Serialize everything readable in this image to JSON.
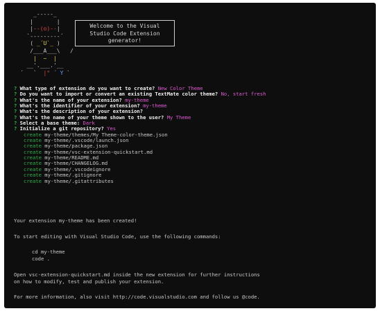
{
  "welcome_box": [
    "Welcome to the Visual",
    "Studio Code Extension",
    "generator!"
  ],
  "prompts": [
    {
      "mark": "?",
      "question": "What type of extension do you want to create?",
      "answer": "New Color Theme"
    },
    {
      "mark": "?",
      "question": "Do you want to import or convert an existing TextMate color theme?",
      "answer": "No, start fresh"
    },
    {
      "mark": "?",
      "question": "What's the name of your extension?",
      "answer": "my-theme"
    },
    {
      "mark": "?",
      "question": "What's the identifier of your extension?",
      "answer": "my-theme"
    },
    {
      "mark": "?",
      "question": "What's the description of your extension?",
      "answer": ""
    },
    {
      "mark": "?",
      "question": "What's the name of your theme shown to the user?",
      "answer": "My Theme"
    },
    {
      "mark": "?",
      "question": "Select a base theme:",
      "answer": "Dark"
    },
    {
      "mark": "?",
      "question": "Initialize a git repository?",
      "answer": "Yes"
    }
  ],
  "create_word": "create",
  "created_files": [
    "my-theme/themes/My Theme-color-theme.json",
    "my-theme/.vscode/launch.json",
    "my-theme/package.json",
    "my-theme/vsc-extension-quickstart.md",
    "my-theme/README.md",
    "my-theme/CHANGELOG.md",
    "my-theme/.vscodeignore",
    "my-theme/.gitignore",
    "my-theme/.gitattributes"
  ],
  "messages": {
    "created": "Your extension my-theme has been created!",
    "start": "To start editing with Visual Studio Code, use the following commands:",
    "cmd1": "cd my-theme",
    "cmd2": "code .",
    "open1": "Open vsc-extension-quickstart.md inside the new extension for further instructions",
    "open2": "on how to modify, test and publish your extension.",
    "more": "For more information, also visit http://code.visualstudio.com and follow us @code."
  },
  "colors": {
    "background": "#0e0e0e",
    "prompt_mark": "#35b24a",
    "answer": "#e05ad2",
    "create": "#2fb04a",
    "text": "#c9c9c9"
  }
}
